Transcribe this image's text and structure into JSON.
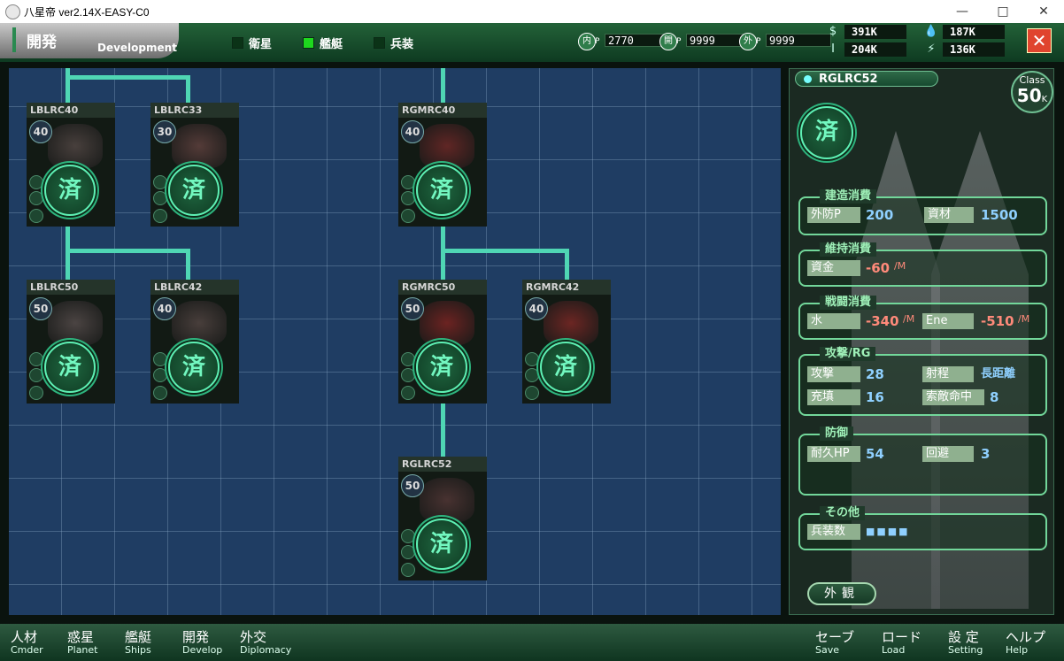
{
  "window": {
    "title": "八星帝 ver2.14X-EASY-C0",
    "minimize": "—",
    "maximize": "□",
    "close": "✕"
  },
  "header": {
    "section_jp": "開発",
    "section_en": "Development",
    "filters": [
      {
        "label": "衛星",
        "color": "#0b3317"
      },
      {
        "label": "艦艇",
        "color": "#1ed81e"
      },
      {
        "label": "兵装",
        "color": "#0b3317"
      }
    ],
    "points": [
      {
        "icon": "内",
        "sub": "P",
        "value": "2770"
      },
      {
        "icon": "開",
        "sub": "P",
        "value": "9999"
      },
      {
        "icon": "外",
        "sub": "P",
        "value": "9999"
      }
    ],
    "resources": [
      {
        "icon": "money-icon",
        "symbol": "$",
        "value": "391K"
      },
      {
        "icon": "water-icon",
        "symbol": "💧",
        "value": "187K"
      },
      {
        "icon": "material-icon",
        "symbol": "I",
        "value": "204K"
      },
      {
        "icon": "energy-icon",
        "symbol": "⚡",
        "value": "136K"
      }
    ],
    "close_label": "✕"
  },
  "tree": {
    "seal_char": "済",
    "ships": [
      {
        "name": "LBLRC40",
        "class": "40",
        "hull_color": "#5a4c4a"
      },
      {
        "name": "LBLRC33",
        "class": "30",
        "hull_color": "#6a4644"
      },
      {
        "name": "RGMRC40",
        "class": "40",
        "hull_color": "#7a2a2a"
      },
      {
        "name": "LBLRC50",
        "class": "50",
        "hull_color": "#5e5252"
      },
      {
        "name": "LBLRC42",
        "class": "40",
        "hull_color": "#5a4a48"
      },
      {
        "name": "RGMRC50",
        "class": "50",
        "hull_color": "#8a2626"
      },
      {
        "name": "RGMRC42",
        "class": "40",
        "hull_color": "#8a2a28"
      },
      {
        "name": "RGLRC52",
        "class": "50",
        "hull_color": "#5a3a3a"
      }
    ]
  },
  "detail": {
    "name": "RGLRC52",
    "class_label": "Class",
    "class_value": "50",
    "class_unit": "K",
    "seal_char": "済",
    "build": {
      "title": "建造消費",
      "l1": "外防P",
      "v1": "200",
      "l2": "資材",
      "v2": "1500"
    },
    "upkeep": {
      "title": "維持消費",
      "l1": "資金",
      "v1": "-60",
      "u1": "/M"
    },
    "battle": {
      "title": "戦闘消費",
      "l1": "水",
      "v1": "-340",
      "u1": "/M",
      "l2": "Ene",
      "v2": "-510",
      "u2": "/M"
    },
    "attack": {
      "title": "攻撃/RG",
      "l1": "攻撃",
      "v1": "28",
      "l2": "射程",
      "v2": "長距離",
      "l3": "充填",
      "v3": "16",
      "l4": "索敵命中",
      "v4": "8"
    },
    "defense": {
      "title": "防御",
      "l1": "耐久HP",
      "v1": "54",
      "l2": "回避",
      "v2": "3"
    },
    "other": {
      "title": "その他",
      "l1": "兵装数",
      "v1": "■■■■"
    },
    "appearance_label": "外観"
  },
  "menu": {
    "left": [
      {
        "jp": "人材",
        "en": "Cmder"
      },
      {
        "jp": "惑星",
        "en": "Planet"
      },
      {
        "jp": "艦艇",
        "en": "Ships"
      },
      {
        "jp": "開発",
        "en": "Develop"
      },
      {
        "jp": "外交",
        "en": "Diplomacy"
      }
    ],
    "right": [
      {
        "jp": "セーブ",
        "en": "Save"
      },
      {
        "jp": "ロード",
        "en": "Load"
      },
      {
        "jp": "設 定",
        "en": "Setting"
      },
      {
        "jp": "ヘルプ",
        "en": "Help"
      }
    ]
  }
}
